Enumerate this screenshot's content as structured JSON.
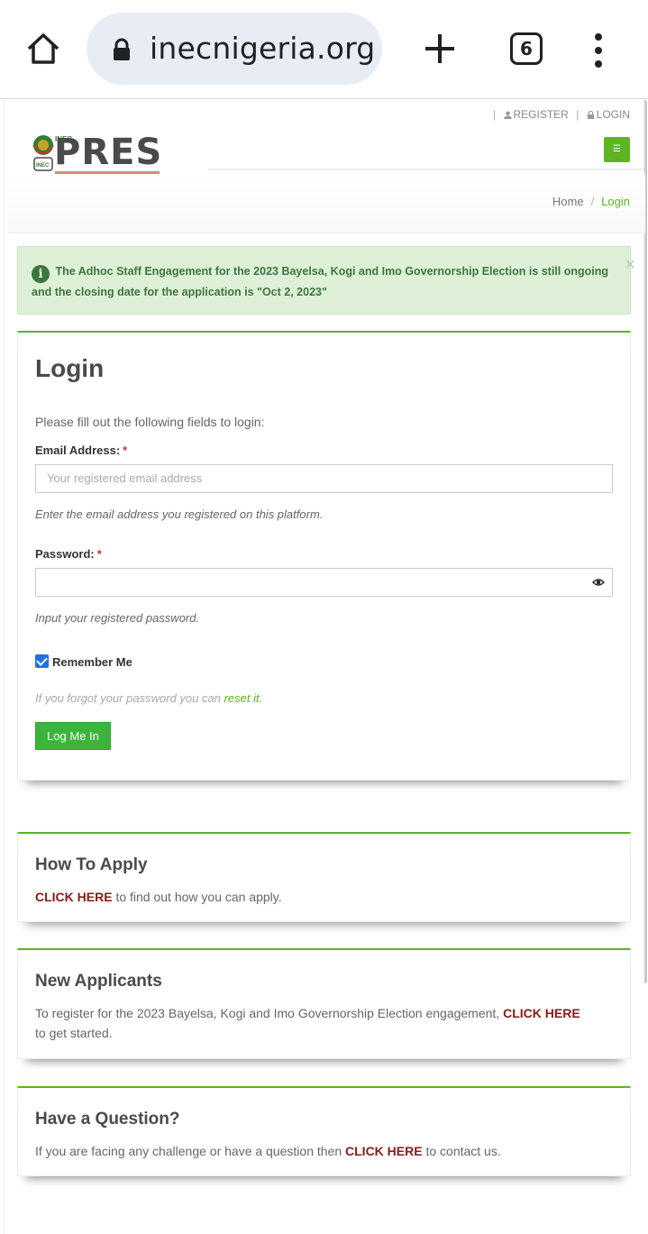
{
  "browser": {
    "url": "inecnigeria.org",
    "tab_count": "6"
  },
  "topnav": {
    "register_label": "REGISTER",
    "login_label": "LOGIN"
  },
  "logo": {
    "small_text": "INEC",
    "word": "PRES"
  },
  "menu_toggle_glyph": "☰",
  "breadcrumb": {
    "home": "Home",
    "separator": "/",
    "current": "Login"
  },
  "alert": {
    "icon": "info-icon",
    "message": "The Adhoc Staff Engagement for the 2023 Bayelsa, Kogi and Imo Governorship Election is still ongoing and the closing date for the application is \"Oct 2, 2023\"",
    "close": "×"
  },
  "login": {
    "title": "Login",
    "intro": "Please fill out the following fields to login:",
    "email_label": "Email Address:",
    "email_placeholder": "Your registered email address",
    "email_hint": "Enter the email address you registered on this platform.",
    "password_label": "Password:",
    "password_value": "",
    "password_hint": "Input your registered password.",
    "required_mark": "*",
    "remember_label": "Remember Me",
    "remember_checked": true,
    "forgot_text": "If you forgot your password you can ",
    "forgot_link": "reset it.",
    "submit_label": "Log Me In"
  },
  "howto": {
    "title": "How To Apply",
    "cta": "CLICK HERE",
    "text": " to find out how you can apply."
  },
  "new_applicants": {
    "title": "New Applicants",
    "text_before": "To register for the 2023 Bayelsa, Kogi and Imo Governorship Election engagement, ",
    "cta": "CLICK HERE",
    "text_after": " to get started."
  },
  "question": {
    "title": "Have a Question?",
    "text_before": "If you are facing any challenge or have a question then ",
    "cta": "CLICK HERE",
    "text_after": " to contact us."
  },
  "colors": {
    "accent_green": "#5cb521",
    "button_green": "#3cb43c",
    "cta_red": "#8b1a1a",
    "alert_bg": "#dff0d8"
  }
}
